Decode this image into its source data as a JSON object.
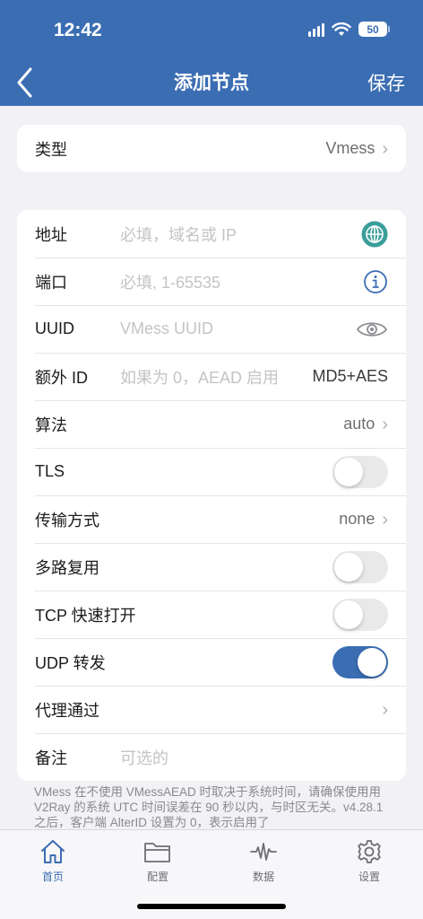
{
  "status": {
    "time": "12:42",
    "battery": "50"
  },
  "nav": {
    "title": "添加节点",
    "save": "保存"
  },
  "type_row": {
    "label": "类型",
    "value": "Vmess"
  },
  "rows": {
    "address": {
      "label": "地址",
      "placeholder": "必填，域名或 IP"
    },
    "port": {
      "label": "端口",
      "placeholder": "必填, 1-65535"
    },
    "uuid": {
      "label": "UUID",
      "placeholder": "VMess UUID"
    },
    "extra_id": {
      "label": "额外 ID",
      "placeholder": "如果为 0，AEAD 启用",
      "value": "MD5+AES"
    },
    "algorithm": {
      "label": "算法",
      "value": "auto"
    },
    "tls": {
      "label": "TLS",
      "on": false
    },
    "transport": {
      "label": "传输方式",
      "value": "none"
    },
    "mux": {
      "label": "多路复用",
      "on": false
    },
    "tcp_fast_open": {
      "label": "TCP 快速打开",
      "on": false
    },
    "udp_relay": {
      "label": "UDP 转发",
      "on": true
    },
    "proxy_via": {
      "label": "代理通过"
    },
    "remark": {
      "label": "备注",
      "placeholder": "可选的"
    }
  },
  "note": "VMess 在不使用 VMessAEAD 时取决于系统时间，请确保使用用 V2Ray 的系统 UTC 时间误差在 90 秒以内，与时区无关。v4.28.1 之后，客户端 AlterID 设置为 0，表示启用了",
  "tabs": [
    {
      "label": "首页",
      "icon": "home-icon",
      "active": true
    },
    {
      "label": "配置",
      "icon": "folder-icon",
      "active": false
    },
    {
      "label": "数据",
      "icon": "waveform-icon",
      "active": false
    },
    {
      "label": "设置",
      "icon": "gear-icon",
      "active": false
    }
  ],
  "colors": {
    "accent": "#3b6db3",
    "globe": "#3a9e9a",
    "background": "#f2f2f6"
  }
}
